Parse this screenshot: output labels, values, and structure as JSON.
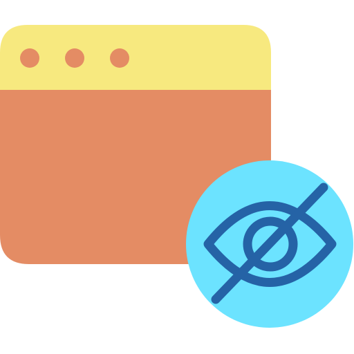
{
  "icon": {
    "name": "hidden-web-page-icon",
    "parts": {
      "window": "browser-window",
      "titlebar_dots": [
        "window-dot",
        "window-dot",
        "window-dot"
      ],
      "badge": "eye-slash-icon"
    }
  },
  "colors": {
    "window_body": "#E48C64",
    "titlebar": "#F7E97F",
    "dots": "#E48C64",
    "badge": "#6CE3FF",
    "eye_stroke": "#2563A6"
  }
}
